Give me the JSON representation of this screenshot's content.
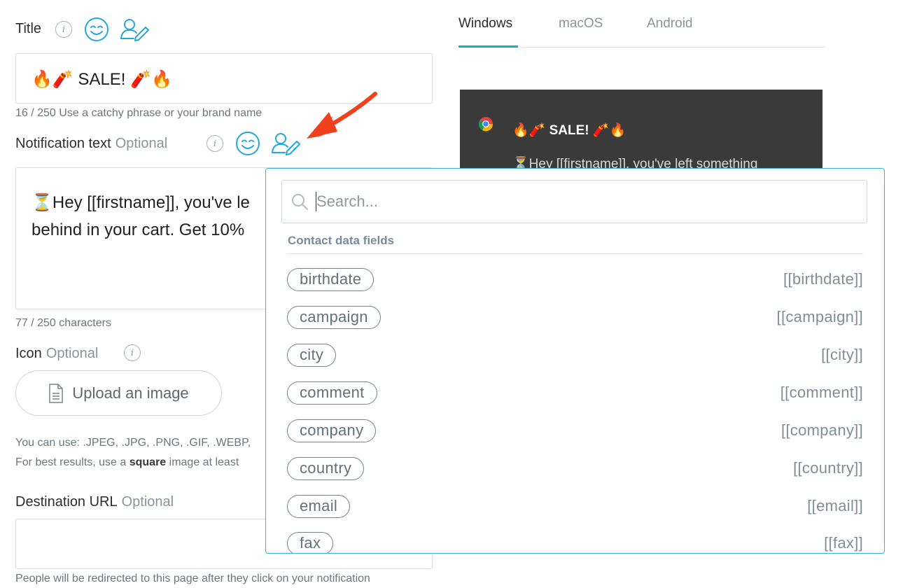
{
  "title_field": {
    "label": "Title",
    "value": "🔥🧨 SALE!  🧨🔥",
    "counter_hint": "16 / 250 Use a catchy phrase or your brand name"
  },
  "notification_field": {
    "label": "Notification text",
    "optional": "Optional",
    "value_line1": "⏳Hey [[firstname]], you've le",
    "value_line2": "behind in your cart. Get 10%",
    "counter": "77 / 250 characters"
  },
  "icon_field": {
    "label": "Icon",
    "optional": "Optional",
    "upload_label": "Upload an image",
    "hint_line1": "You can use: .JPEG, .JPG, .PNG, .GIF, .WEBP,",
    "hint_line2_pre": "For best results, use a ",
    "hint_line2_bold": "square",
    "hint_line2_post": " image at least"
  },
  "url_field": {
    "label": "Destination URL",
    "optional": "Optional",
    "hint": "People will be redirected to this page after they click on your notification"
  },
  "info_glyph": "i",
  "tabs": [
    {
      "label": "Windows",
      "active": true
    },
    {
      "label": "macOS",
      "active": false
    },
    {
      "label": "Android",
      "active": false
    }
  ],
  "preview": {
    "title": "🔥🧨 SALE! 🧨🔥",
    "body": "⏳Hey [[firstname]], you've left something"
  },
  "dropdown": {
    "search_placeholder": "Search...",
    "section_title": "Contact data fields",
    "items": [
      {
        "label": "birthdate",
        "tag": "[[birthdate]]"
      },
      {
        "label": "campaign",
        "tag": "[[campaign]]"
      },
      {
        "label": "city",
        "tag": "[[city]]"
      },
      {
        "label": "comment",
        "tag": "[[comment]]"
      },
      {
        "label": "company",
        "tag": "[[company]]"
      },
      {
        "label": "country",
        "tag": "[[country]]"
      },
      {
        "label": "email",
        "tag": "[[email]]"
      },
      {
        "label": "fax",
        "tag": "[[fax]]"
      }
    ]
  },
  "colors": {
    "accent": "#1ea6d8",
    "dropdown_border": "#36b1e0",
    "annotation_arrow": "#f0401c",
    "preview_bg": "#3a3a3a"
  }
}
